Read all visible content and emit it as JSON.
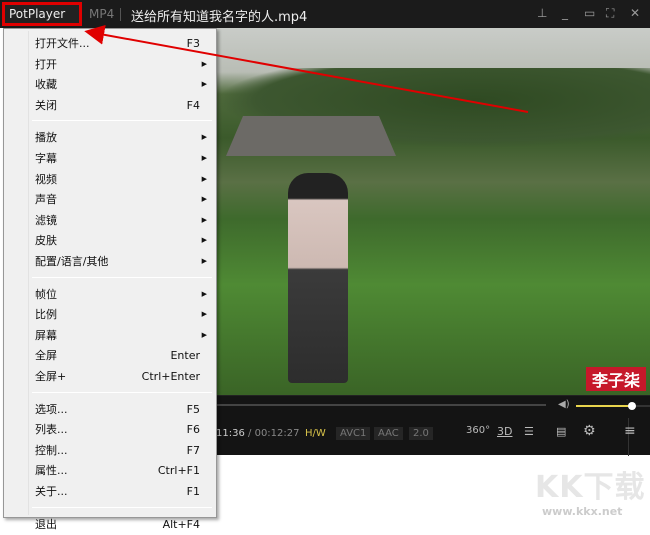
{
  "titlebar": {
    "app_label": "PotPlayer",
    "format": "MP4",
    "title": "送给所有知道我名字的人.mp4"
  },
  "video": {
    "watermark": "李子柒"
  },
  "controls": {
    "time_current": "11:36",
    "time_sep": "/",
    "time_total": "00:12:27",
    "hw": "H/W",
    "video_codec": "AVC1",
    "audio_codec": "AAC",
    "channels": "2.0",
    "btn_360": "360°",
    "btn_3d": "3D",
    "volume_percent": 70
  },
  "menu": {
    "groups": [
      [
        {
          "label": "打开文件...",
          "shortcut": "F3"
        },
        {
          "label": "打开",
          "submenu": true
        },
        {
          "label": "收藏",
          "submenu": true
        },
        {
          "label": "关闭",
          "shortcut": "F4"
        }
      ],
      [
        {
          "label": "播放",
          "submenu": true
        },
        {
          "label": "字幕",
          "submenu": true
        },
        {
          "label": "视频",
          "submenu": true
        },
        {
          "label": "声音",
          "submenu": true
        },
        {
          "label": "滤镜",
          "submenu": true
        },
        {
          "label": "皮肤",
          "submenu": true
        },
        {
          "label": "配置/语言/其他",
          "submenu": true
        }
      ],
      [
        {
          "label": "帧位",
          "submenu": true
        },
        {
          "label": "比例",
          "submenu": true
        },
        {
          "label": "屏幕",
          "submenu": true
        },
        {
          "label": "全屏",
          "shortcut": "Enter"
        },
        {
          "label": "全屏+",
          "shortcut": "Ctrl+Enter"
        }
      ],
      [
        {
          "label": "选项...",
          "shortcut": "F5"
        },
        {
          "label": "列表...",
          "shortcut": "F6"
        },
        {
          "label": "控制...",
          "shortcut": "F7"
        },
        {
          "label": "属性...",
          "shortcut": "Ctrl+F1"
        },
        {
          "label": "关于...",
          "shortcut": "F1"
        }
      ],
      [
        {
          "label": "退出",
          "shortcut": "Alt+F4"
        }
      ]
    ]
  },
  "site_watermark": {
    "logo": "KK下载",
    "url": "www.kkx.net"
  },
  "colors": {
    "highlight": "#e00000",
    "accent": "#e8d44d"
  }
}
